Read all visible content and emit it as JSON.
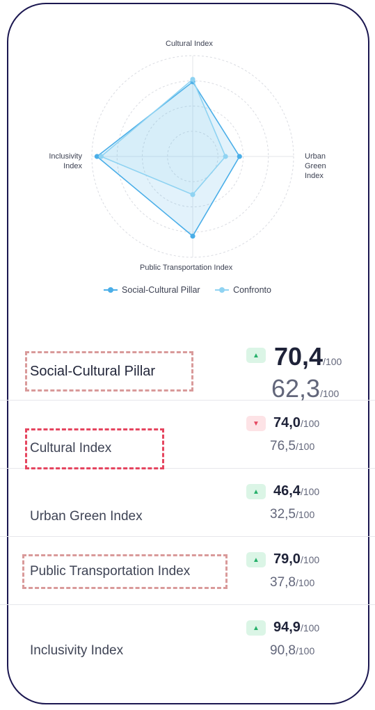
{
  "chart_data": {
    "type": "radar",
    "axes": [
      "Cultural Index",
      "Urban Green Index",
      "Public Transportation Index",
      "Inclusivity Index"
    ],
    "rlim": [
      0,
      100
    ],
    "series": [
      {
        "name": "Social-Cultural Pillar",
        "values": [
          74.0,
          46.4,
          79.0,
          94.9
        ]
      },
      {
        "name": "Confronto",
        "values": [
          76.5,
          32.5,
          37.8,
          90.8
        ]
      }
    ],
    "grid": true,
    "legend_position": "bottom"
  },
  "chart": {
    "axis_labels": {
      "top": "Cultural Index",
      "right_lines": [
        "Urban",
        "Green",
        "Index"
      ],
      "bottom": "Public Transportation Index",
      "left_lines": [
        "Inclusivity",
        "Index"
      ]
    },
    "legend": [
      {
        "label": "Social-Cultural Pillar",
        "color": "#4aaee8"
      },
      {
        "label": "Confronto",
        "color": "#8fd3f2"
      }
    ]
  },
  "rows": [
    {
      "label": "Social-Cultural Pillar",
      "trend": "up",
      "value": "70,4",
      "compare": "62,3",
      "unit": "/100"
    },
    {
      "label": "Cultural Index",
      "trend": "down",
      "value": "74,0",
      "compare": "76,5",
      "unit": "/100"
    },
    {
      "label": "Urban Green Index",
      "trend": "up",
      "value": "46,4",
      "compare": "32,5",
      "unit": "/100"
    },
    {
      "label": "Public Transportation Index",
      "trend": "up",
      "value": "79,0",
      "compare": "37,8",
      "unit": "/100"
    },
    {
      "label": "Inclusivity Index",
      "trend": "up",
      "value": "94,9",
      "compare": "90,8",
      "unit": "/100"
    }
  ],
  "colors": {
    "up": "#25b06a",
    "down": "#e5455f",
    "frame": "#1b1750"
  }
}
